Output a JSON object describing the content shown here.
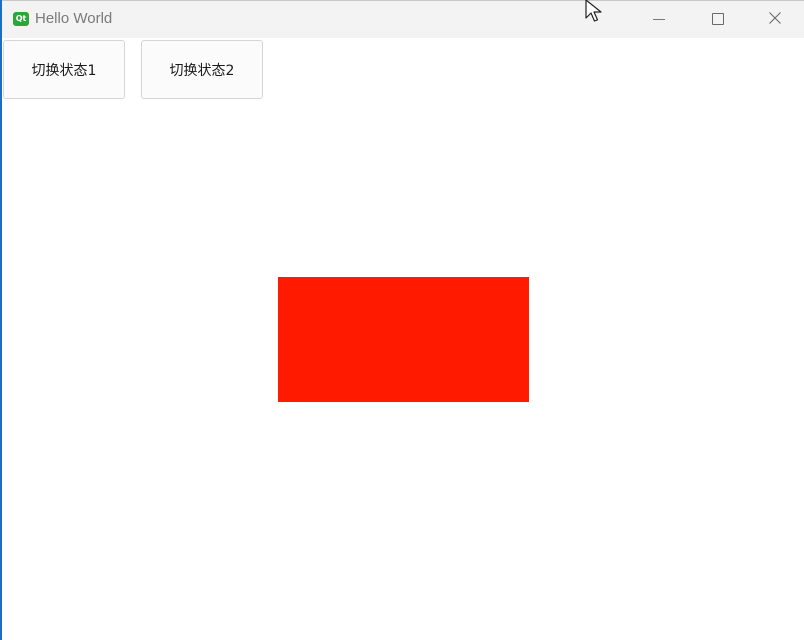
{
  "window": {
    "title": "Hello World",
    "app_icon_text": "Qt"
  },
  "controls": {
    "minimize_icon": "minimize-icon",
    "maximize_icon": "maximize-icon",
    "close_icon": "close-icon"
  },
  "buttons": {
    "state1_label": "切换状态1",
    "state2_label": "切换状态2"
  },
  "shape": {
    "color": "#ff1a00"
  },
  "colors": {
    "desktop_accent": "#1a6fc4",
    "titlebar": "#f3f3f3",
    "qt_icon": "#2aa63a"
  }
}
